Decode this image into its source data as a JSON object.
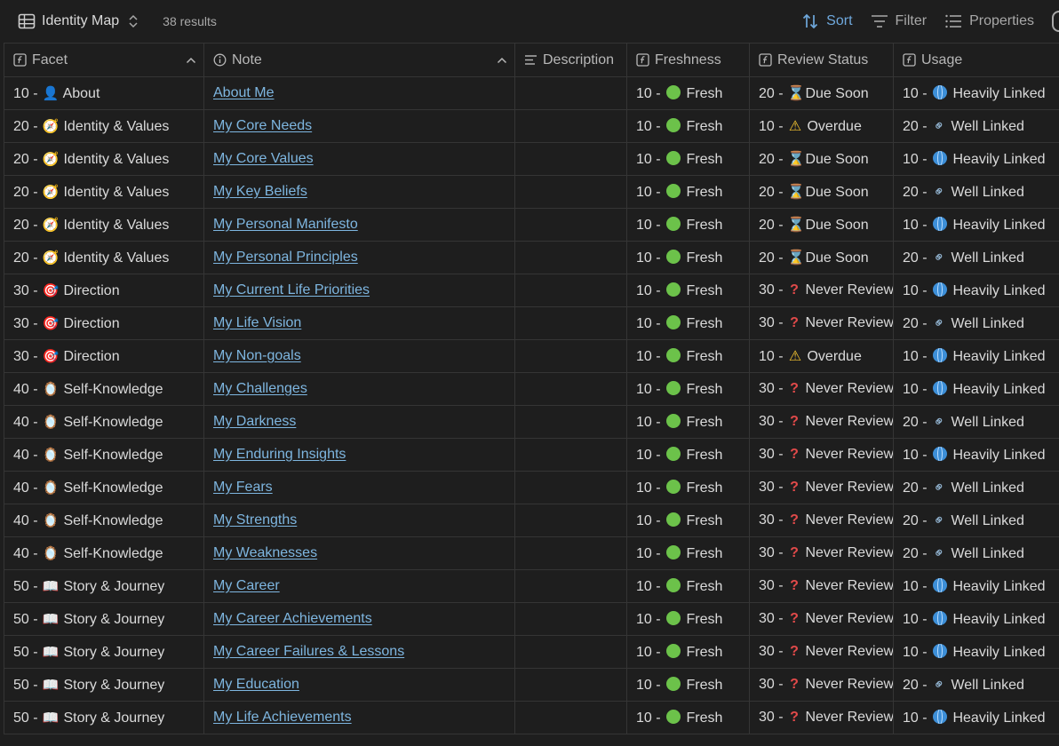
{
  "toolbar": {
    "view_title": "Identity Map",
    "result_count": "38 results",
    "sort_label": "Sort",
    "filter_label": "Filter",
    "properties_label": "Properties"
  },
  "columns": {
    "facet": "Facet",
    "note": "Note",
    "description": "Description",
    "freshness": "Freshness",
    "review_status": "Review Status",
    "usage": "Usage"
  },
  "facets": {
    "about": {
      "prefix": "10 - ",
      "emoji": "👤",
      "label": "About"
    },
    "identity": {
      "prefix": "20 - ",
      "emoji": "🧭",
      "label": "Identity & Values"
    },
    "direction": {
      "prefix": "30 - ",
      "emoji": "🎯",
      "label": "Direction"
    },
    "self": {
      "prefix": "40 - ",
      "emoji": "🪞",
      "label": "Self-Knowledge"
    },
    "story": {
      "prefix": "50 - ",
      "emoji": "📖",
      "label": "Story & Journey"
    }
  },
  "freshness": {
    "fresh": {
      "prefix": "10 - ",
      "label": "Fresh"
    }
  },
  "review": {
    "due": {
      "prefix": "20 - ",
      "label": "Due Soon"
    },
    "overdue": {
      "prefix": "10 - ",
      "label": "Overdue"
    },
    "never": {
      "prefix": "30 - ",
      "label": "Never Reviewed"
    }
  },
  "usage": {
    "heavy": {
      "prefix": "10 - ",
      "label": "Heavily Linked"
    },
    "well": {
      "prefix": "20 - ",
      "label": "Well Linked"
    }
  },
  "rows": [
    {
      "facet": "about",
      "note": "About Me",
      "description": "",
      "fresh": "fresh",
      "review": "due",
      "usage": "heavy"
    },
    {
      "facet": "identity",
      "note": "My Core Needs",
      "description": "",
      "fresh": "fresh",
      "review": "overdue",
      "usage": "well"
    },
    {
      "facet": "identity",
      "note": "My Core Values",
      "description": "",
      "fresh": "fresh",
      "review": "due",
      "usage": "heavy"
    },
    {
      "facet": "identity",
      "note": "My Key Beliefs",
      "description": "",
      "fresh": "fresh",
      "review": "due",
      "usage": "well"
    },
    {
      "facet": "identity",
      "note": "My Personal Manifesto",
      "description": "",
      "fresh": "fresh",
      "review": "due",
      "usage": "heavy"
    },
    {
      "facet": "identity",
      "note": "My Personal Principles",
      "description": "",
      "fresh": "fresh",
      "review": "due",
      "usage": "well"
    },
    {
      "facet": "direction",
      "note": "My Current Life Priorities",
      "description": "",
      "fresh": "fresh",
      "review": "never",
      "usage": "heavy"
    },
    {
      "facet": "direction",
      "note": "My Life Vision",
      "description": "",
      "fresh": "fresh",
      "review": "never",
      "usage": "well"
    },
    {
      "facet": "direction",
      "note": "My Non-goals",
      "description": "",
      "fresh": "fresh",
      "review": "overdue",
      "usage": "heavy"
    },
    {
      "facet": "self",
      "note": "My Challenges",
      "description": "",
      "fresh": "fresh",
      "review": "never",
      "usage": "heavy"
    },
    {
      "facet": "self",
      "note": "My Darkness",
      "description": "",
      "fresh": "fresh",
      "review": "never",
      "usage": "well"
    },
    {
      "facet": "self",
      "note": "My Enduring Insights",
      "description": "",
      "fresh": "fresh",
      "review": "never",
      "usage": "heavy"
    },
    {
      "facet": "self",
      "note": "My Fears",
      "description": "",
      "fresh": "fresh",
      "review": "never",
      "usage": "well"
    },
    {
      "facet": "self",
      "note": "My Strengths",
      "description": "",
      "fresh": "fresh",
      "review": "never",
      "usage": "well"
    },
    {
      "facet": "self",
      "note": "My Weaknesses",
      "description": "",
      "fresh": "fresh",
      "review": "never",
      "usage": "well"
    },
    {
      "facet": "story",
      "note": "My Career",
      "description": "",
      "fresh": "fresh",
      "review": "never",
      "usage": "heavy"
    },
    {
      "facet": "story",
      "note": "My Career Achievements",
      "description": "",
      "fresh": "fresh",
      "review": "never",
      "usage": "heavy"
    },
    {
      "facet": "story",
      "note": "My Career Failures & Lessons",
      "description": "",
      "fresh": "fresh",
      "review": "never",
      "usage": "heavy"
    },
    {
      "facet": "story",
      "note": "My Education",
      "description": "",
      "fresh": "fresh",
      "review": "never",
      "usage": "well"
    },
    {
      "facet": "story",
      "note": "My Life Achievements",
      "description": "",
      "fresh": "fresh",
      "review": "never",
      "usage": "heavy"
    }
  ],
  "colors": {
    "background": "#1e1e1e",
    "border": "#353535",
    "link": "#7eb6e0",
    "accent": "#6fa8dc"
  }
}
